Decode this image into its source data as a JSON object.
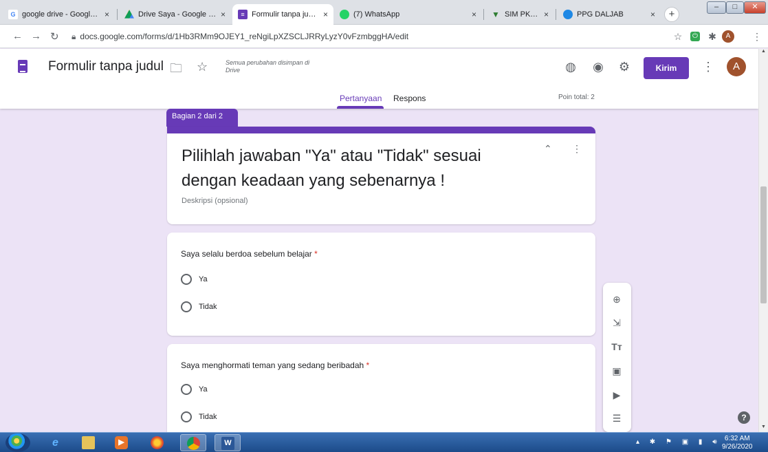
{
  "browser": {
    "tabs": [
      {
        "label": "google drive - Google S",
        "fav_color": "#4285f4",
        "fav": "G"
      },
      {
        "label": "Drive Saya - Google Driv",
        "fav_color": "#0f9d58",
        "fav": ""
      },
      {
        "label": "Formulir tanpa judul - G",
        "fav_color": "#673ab7",
        "fav": "≡"
      },
      {
        "label": "(7) WhatsApp",
        "fav_color": "#25d366",
        "fav": ""
      },
      {
        "label": "SIM PKB PPG Prajabatan",
        "fav_color": "#2e7d32",
        "fav": "▼"
      },
      {
        "label": "PPG DALJAB",
        "fav_color": "#1e88e5",
        "fav": ""
      }
    ],
    "close_glyph": "×",
    "new_tab": "+",
    "url": "docs.google.com/forms/d/1Hb3RMm9OJEY1_reNgiLpXZSCLJRRyLyzY0vFzmbggHA/edit",
    "window_controls": [
      "–",
      "□",
      "✕"
    ]
  },
  "form_header": {
    "title": "Formulir tanpa judul",
    "save_note": "Semua perubahan disimpan di Drive",
    "send_label": "Kirim",
    "avatar_letter": "A",
    "tabs": {
      "questions": "Pertanyaan",
      "responses": "Respons"
    },
    "points": "Poin total: 2"
  },
  "section": {
    "tag": "Bagian 2 dari 2",
    "title": "Pilihlah jawaban \"Ya\" atau \"Tidak\" sesuai dengan keadaan yang sebenarnya !",
    "description": "Deskripsi (opsional)"
  },
  "questions": [
    {
      "title": "Saya selalu berdoa sebelum belajar",
      "required": "*",
      "options": [
        "Ya",
        "Tidak"
      ]
    },
    {
      "title": "Saya menghormati teman yang sedang beribadah",
      "required": "*",
      "options": [
        "Ya",
        "Tidak"
      ]
    }
  ],
  "taskbar": {
    "clock_time": "6:32 AM",
    "clock_date": "9/26/2020"
  },
  "colors": {
    "accent": "#673ab7",
    "background": "#ece3f6",
    "required": "#d93025"
  }
}
